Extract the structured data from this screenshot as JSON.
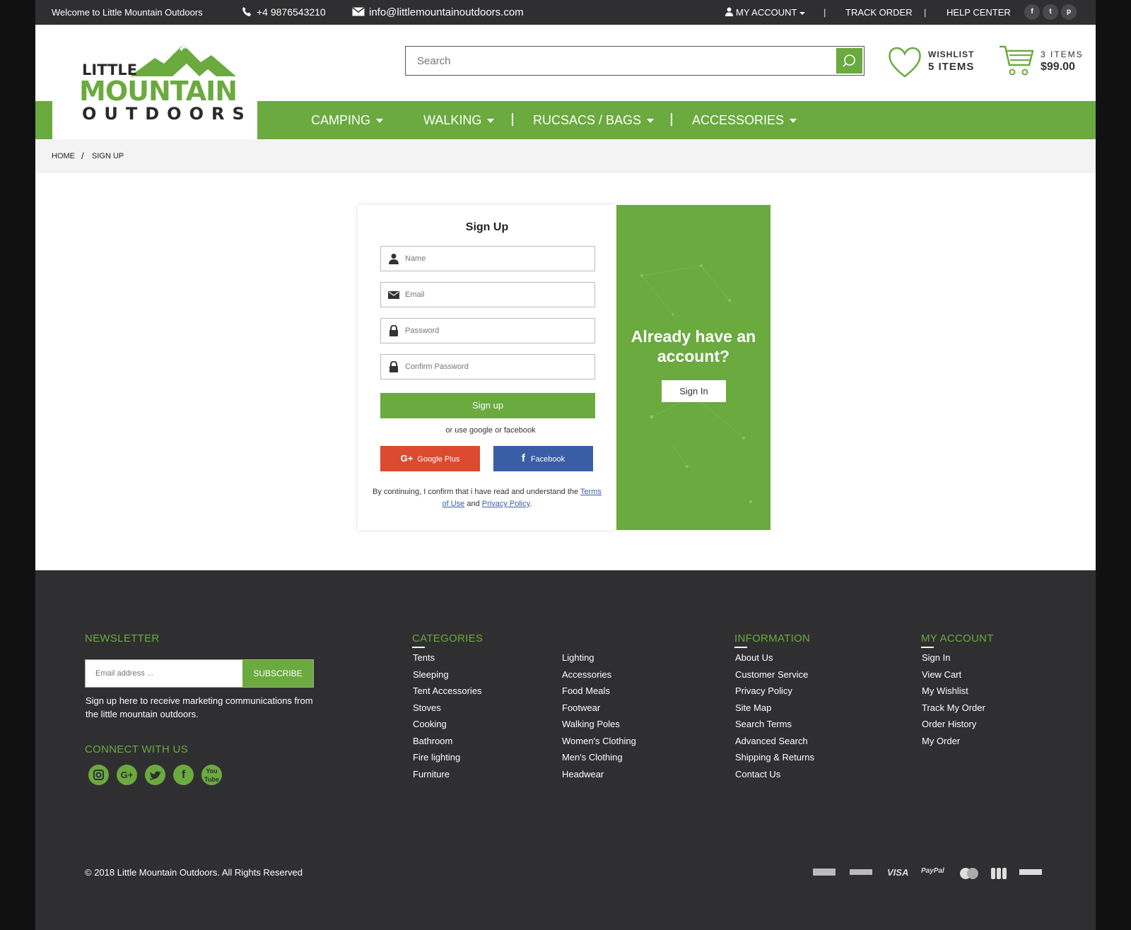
{
  "topbar": {
    "welcome": "Welcome to Little Mountain Outdoors",
    "phone": "+4 9876543210",
    "email": "info@littlemountainoutdoors.com",
    "my_account": "MY ACCOUNT",
    "track_order": "TRACK ORDER",
    "help_center": "HELP CENTER",
    "social": [
      "f",
      "t",
      "p"
    ]
  },
  "logo": {
    "line1": "LITTLE",
    "line2": "MOUNTAIN",
    "line3": "OUTDOORS"
  },
  "search": {
    "placeholder": "Search"
  },
  "wishlist": {
    "label": "WISHLIST",
    "value": "5 ITEMS"
  },
  "cart": {
    "label": "3 ITEMS",
    "value": "$99.00"
  },
  "nav": {
    "items": [
      "CAMPING",
      "WALKING",
      "RUCSACS / BAGS",
      "ACCESSORIES"
    ]
  },
  "breadcrumb": {
    "home": "HOME",
    "sep": "/",
    "current": "SIGN UP"
  },
  "signup": {
    "title": "Sign Up",
    "name_ph": "Name",
    "email_ph": "Email",
    "password_ph": "Password",
    "confirm_ph": "Confirm Password",
    "button": "Sign up",
    "or_text": "or use google or facebook",
    "google": "Google Plus",
    "facebook": "Facebook",
    "terms_prefix": "By continuing, I confirm that i have read and understand the",
    "terms_link": "Terms of Use",
    "and": "and",
    "privacy_link": "Privacy Policy",
    "period": "."
  },
  "panel": {
    "heading": "Already have an account?",
    "button": "Sign In"
  },
  "footer": {
    "newsletter": {
      "title": "NEWSLETTER",
      "placeholder": "Email address ...",
      "button": "SUBSCRIBE",
      "text": "Sign up here to receive marketing communications from the little mountain outdoors."
    },
    "connect": {
      "title": "CONNECT WITH US"
    },
    "categories": {
      "title": "CATEGORIES",
      "col1": [
        "Tents",
        "Sleeping",
        "Tent Accessories",
        "Stoves",
        "Cooking",
        "Bathroom",
        "Fire lighting",
        "Furniture"
      ],
      "col2": [
        "Lighting",
        "Accessories",
        "Food Meals",
        "Footwear",
        "Walking Poles",
        "Women's Clothing",
        "Men's Clothing",
        "Headwear"
      ]
    },
    "information": {
      "title": "INFORMATION",
      "items": [
        "About Us",
        "Customer Service",
        "Privacy Policy",
        "Site Map",
        "Search Terms",
        "Advanced Search",
        "Shipping & Returns",
        "Contact Us"
      ]
    },
    "account": {
      "title": "MY ACCOUNT",
      "items": [
        "Sign In",
        "View Cart",
        "My Wishlist",
        "Track My Order",
        "Order History",
        "My Order"
      ]
    },
    "copyright": "© 2018 Little Mountain Outdoors. All Rights Reserved",
    "payments": [
      "VISA",
      "PayPal"
    ]
  }
}
